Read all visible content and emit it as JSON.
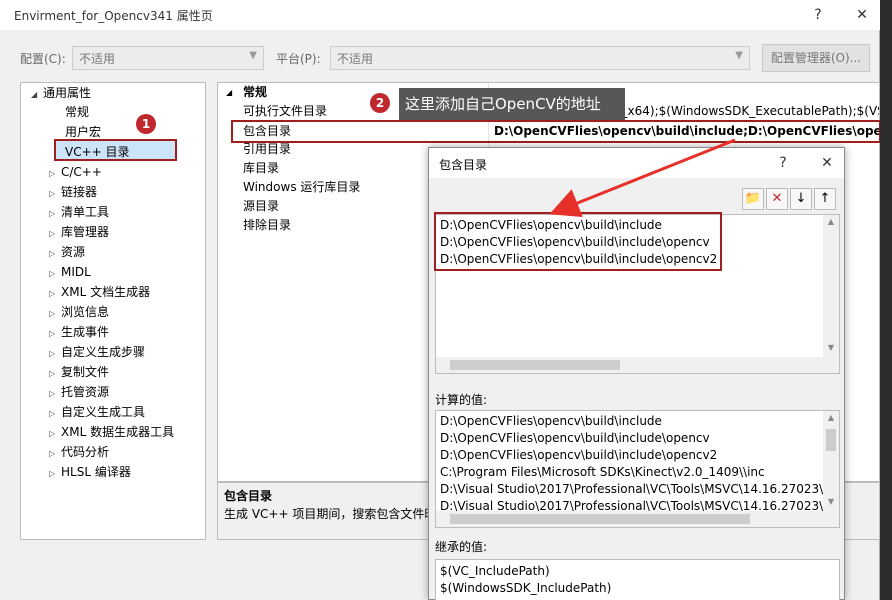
{
  "window": {
    "title": "Envirment_for_Opencv341 属性页",
    "help_glyph": "?",
    "close_glyph": "✕"
  },
  "config": {
    "config_label": "配置(C):",
    "config_value": "不适用",
    "platform_label": "平台(P):",
    "platform_value": "不适用",
    "manager_button": "配置管理器(O)..."
  },
  "tree": {
    "root": "通用属性",
    "items": [
      "常规",
      "用户宏",
      "VC++ 目录",
      "C/C++",
      "链接器",
      "清单工具",
      "库管理器",
      "资源",
      "MIDL",
      "XML 文档生成器",
      "浏览信息",
      "生成事件",
      "自定义生成步骤",
      "复制文件",
      "托管资源",
      "自定义生成工具",
      "XML 数据生成器工具",
      "代码分析",
      "HLSL 编译器"
    ]
  },
  "grid": {
    "section": "常规",
    "rows": [
      {
        "name": "可执行文件目录",
        "value": "$(VC_ExecutablePath_x64);$(WindowsSDK_ExecutablePath);$(VS_E"
      },
      {
        "name": "包含目录",
        "value": "D:\\OpenCVFlies\\opencv\\build\\include;D:\\OpenCVFlies\\openc"
      },
      {
        "name": "引用目录",
        "value": ""
      },
      {
        "name": "库目录",
        "value": ""
      },
      {
        "name": "Windows 运行库目录",
        "value": ""
      },
      {
        "name": "源目录",
        "value": ""
      },
      {
        "name": "排除目录",
        "value": ""
      }
    ]
  },
  "description": {
    "title": "包含目录",
    "text": "生成 VC++ 项目期间，搜索包含文件时"
  },
  "dialog": {
    "title": "包含目录",
    "help_glyph": "?",
    "close_glyph": "✕",
    "tools": [
      "📁",
      "✕",
      "↓",
      "↑"
    ],
    "entries": [
      "D:\\OpenCVFlies\\opencv\\build\\include",
      "D:\\OpenCVFlies\\opencv\\build\\include\\opencv",
      "D:\\OpenCVFlies\\opencv\\build\\include\\opencv2"
    ],
    "computed_label": "计算的值:",
    "computed": [
      "D:\\OpenCVFlies\\opencv\\build\\include",
      "D:\\OpenCVFlies\\opencv\\build\\include\\opencv",
      "D:\\OpenCVFlies\\opencv\\build\\include\\opencv2",
      "C:\\Program Files\\Microsoft SDKs\\Kinect\\v2.0_1409\\\\inc",
      "D:\\Visual Studio\\2017\\Professional\\VC\\Tools\\MSVC\\14.16.27023\\i",
      "D:\\Visual Studio\\2017\\Professional\\VC\\Tools\\MSVC\\14.16.27023\\i"
    ],
    "inherited_label": "继承的值:",
    "inherited": [
      "$(VC_IncludePath)",
      "$(WindowsSDK_IncludePath)"
    ]
  },
  "annotations": {
    "badge1": "1",
    "badge2": "2",
    "callout": "这里添加自己OpenCV的地址",
    "accent": "#a01e1e",
    "arrow_color": "#e8302a"
  }
}
